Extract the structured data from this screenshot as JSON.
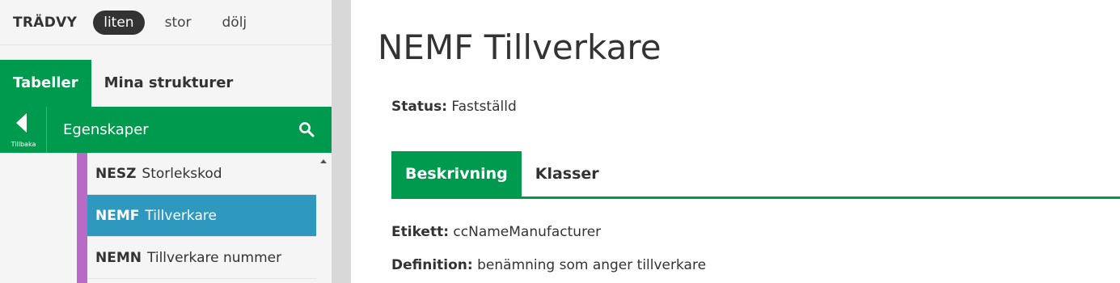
{
  "treeview": {
    "title": "TRÄDVY",
    "options": [
      "liten",
      "stor",
      "dölj"
    ],
    "active_option": "liten"
  },
  "sidebar": {
    "tabs": [
      "Tabeller",
      "Mina strukturer"
    ],
    "active_tab": "Tabeller",
    "back_label": "Tillbaka",
    "section_title": "Egenskaper",
    "items": [
      {
        "code": "NESZ",
        "name": "Storlekskod"
      },
      {
        "code": "NEMF",
        "name": "Tillverkare"
      },
      {
        "code": "NEMN",
        "name": "Tillverkare nummer"
      }
    ],
    "selected_item": "NEMF"
  },
  "main": {
    "title": "NEMF Tillverkare",
    "status_label": "Status:",
    "status_value": "Fastställd",
    "tabs": [
      "Beskrivning",
      "Klasser"
    ],
    "active_tab": "Beskrivning",
    "fields": [
      {
        "label": "Etikett:",
        "value": "ccNameManufacturer"
      },
      {
        "label": "Definition:",
        "value": "benämning som anger tillverkare"
      }
    ]
  },
  "colors": {
    "brand_green": "#009a4e",
    "selected_blue": "#2e98be",
    "tree_bar_purple": "#b96ac7"
  }
}
